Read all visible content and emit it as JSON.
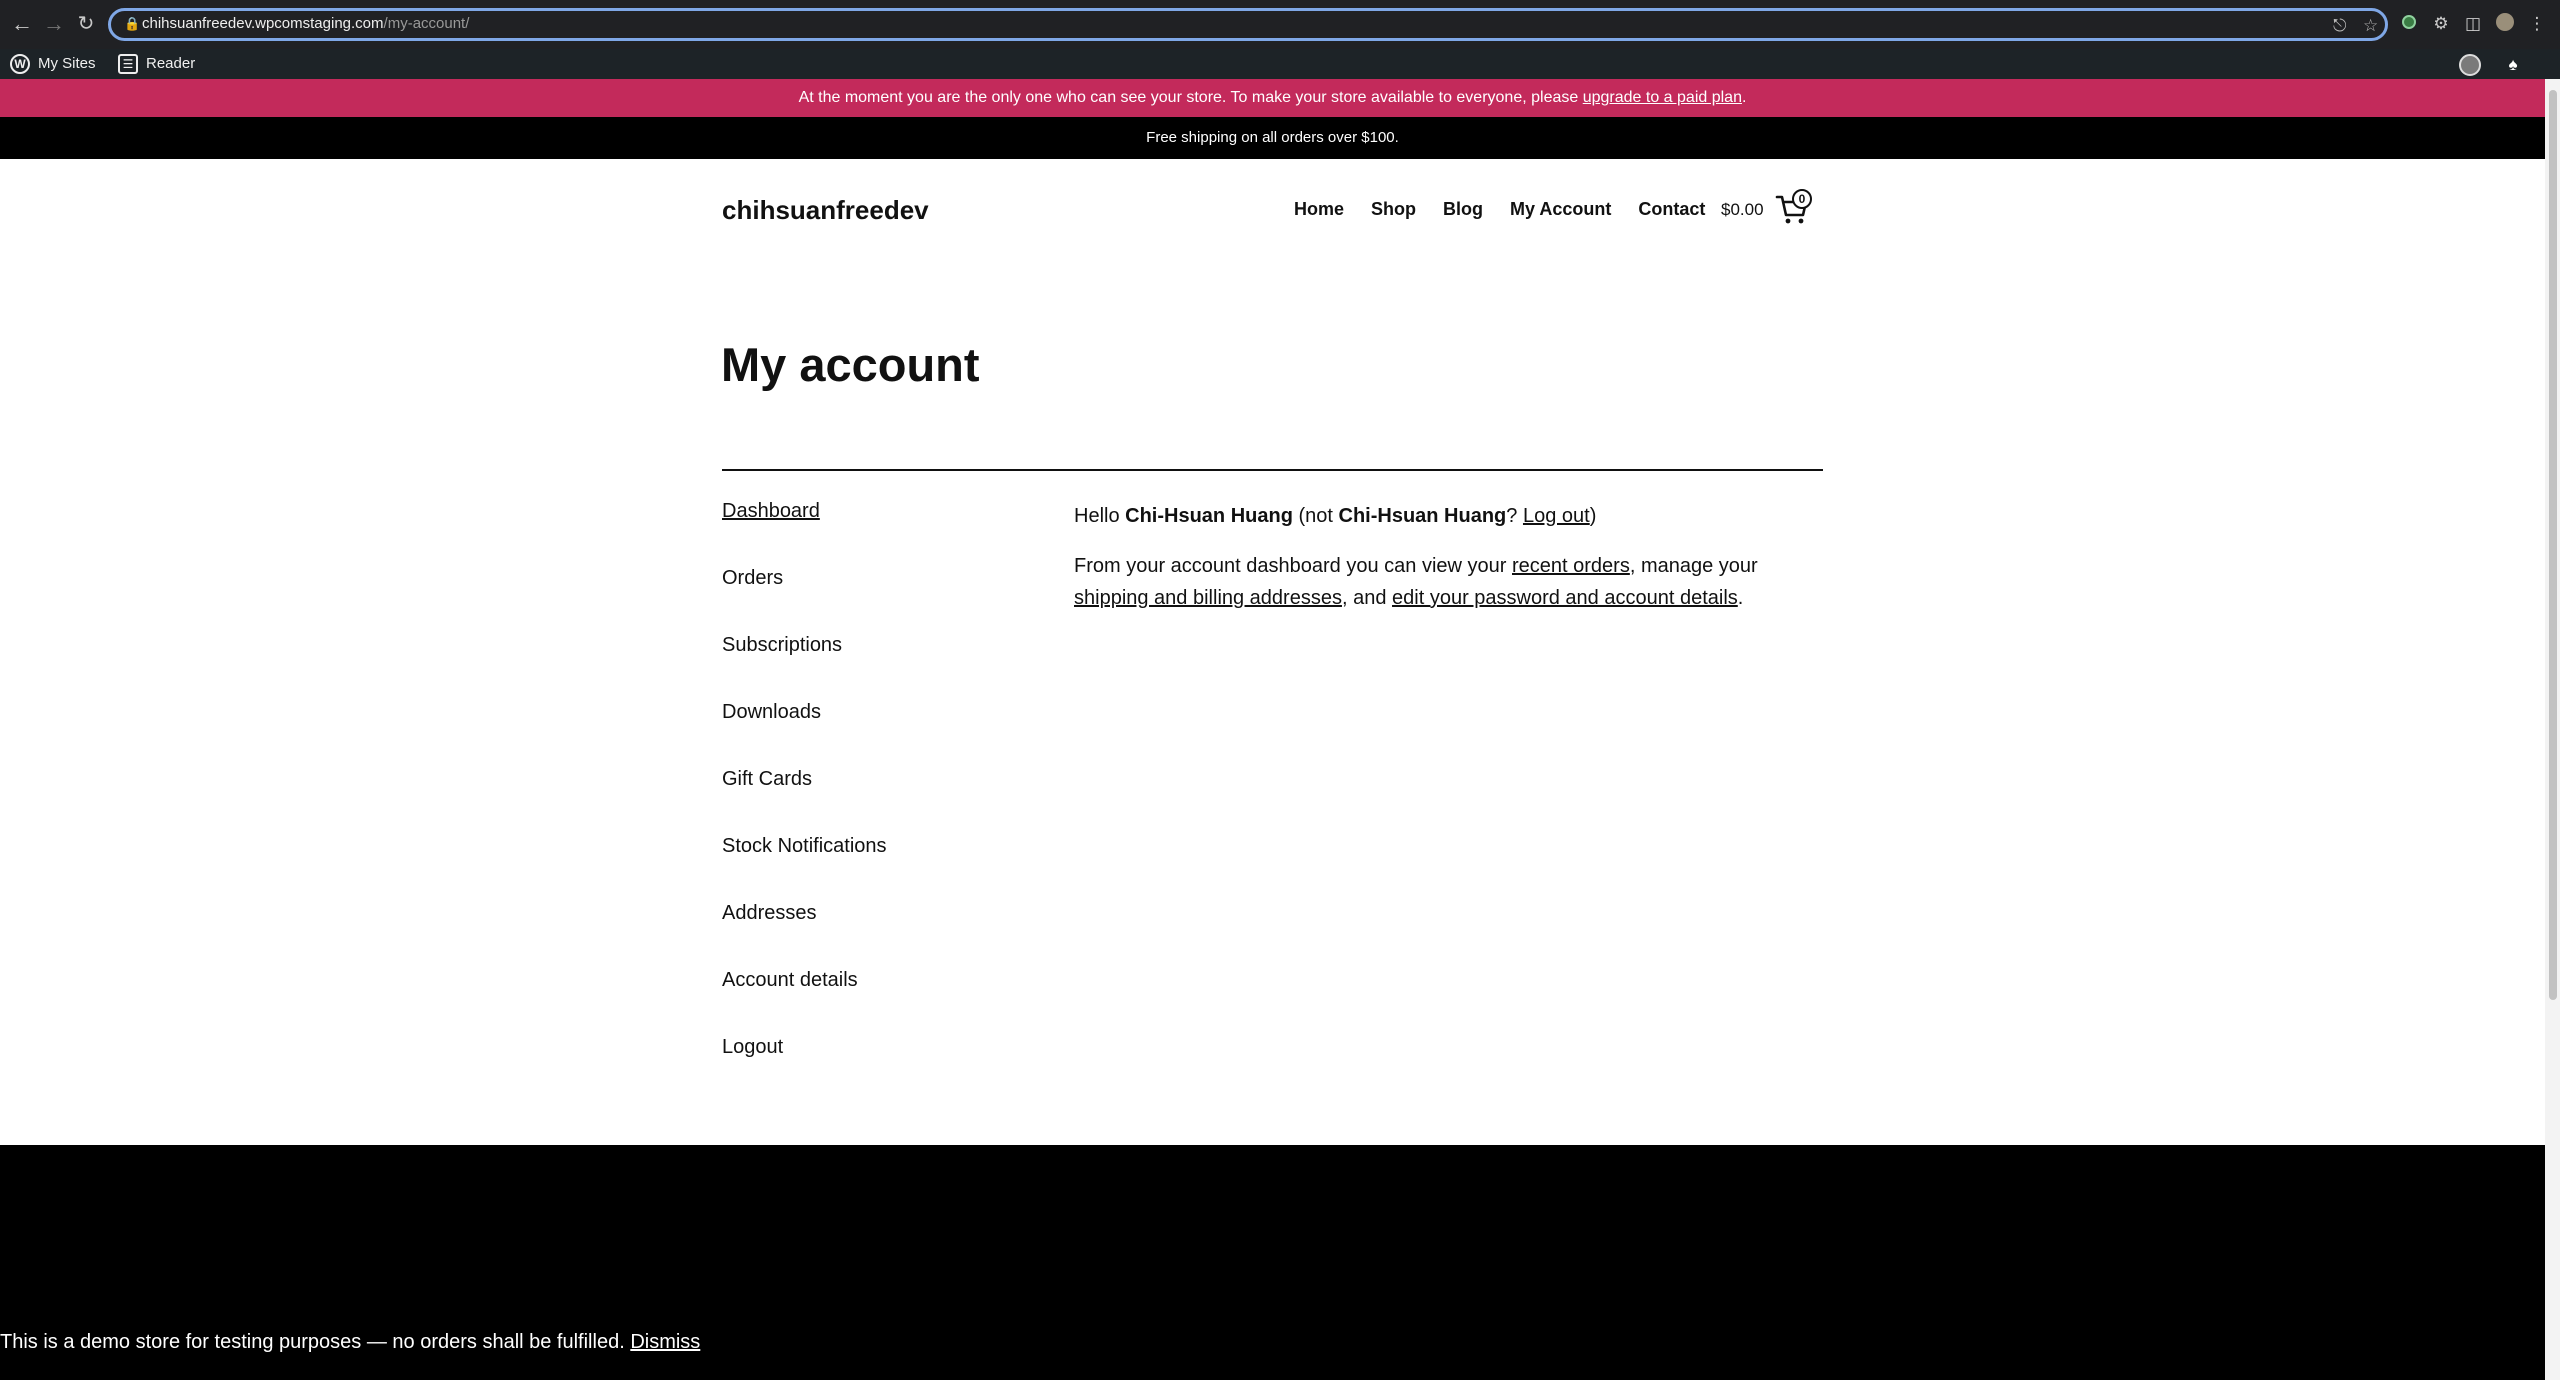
{
  "browser": {
    "url_domain": "chihsuanfreedev.wpcomstaging.com",
    "url_path": "/my-account/"
  },
  "admin_bar": {
    "my_sites": "My Sites",
    "reader": "Reader"
  },
  "notices": {
    "private_store_text": "At the moment you are the only one who can see your store. To make your store available to everyone, please ",
    "private_store_link": "upgrade to a paid plan",
    "private_store_end": ".",
    "shipping": "Free shipping on all orders over $100."
  },
  "header": {
    "site_title": "chihsuanfreedev",
    "nav": [
      "Home",
      "Shop",
      "Blog",
      "My Account",
      "Contact"
    ],
    "cart_total": "$0.00",
    "cart_count": "0"
  },
  "page": {
    "title": "My account"
  },
  "account_nav": {
    "items": [
      "Dashboard",
      "Orders",
      "Subscriptions",
      "Downloads",
      "Gift Cards",
      "Stock Notifications",
      "Addresses",
      "Account details",
      "Logout"
    ]
  },
  "dashboard": {
    "hello": "Hello ",
    "user_name": "Chi-Hsuan Huang",
    "not_prefix": " (not ",
    "not_user": "Chi-Hsuan Huang",
    "not_q": "? ",
    "logout_link": "Log out",
    "close_paren": ")",
    "intro_1": "From your account dashboard you can view your ",
    "recent_orders": "recent orders",
    "intro_2": ", manage your ",
    "addresses_link": "shipping and billing addresses",
    "intro_3": ", and ",
    "account_link": "edit your password and account details",
    "intro_4": "."
  },
  "footer": {
    "demo_text": "This is a demo store for testing purposes — no orders shall be fulfilled. ",
    "dismiss": "Dismiss"
  }
}
